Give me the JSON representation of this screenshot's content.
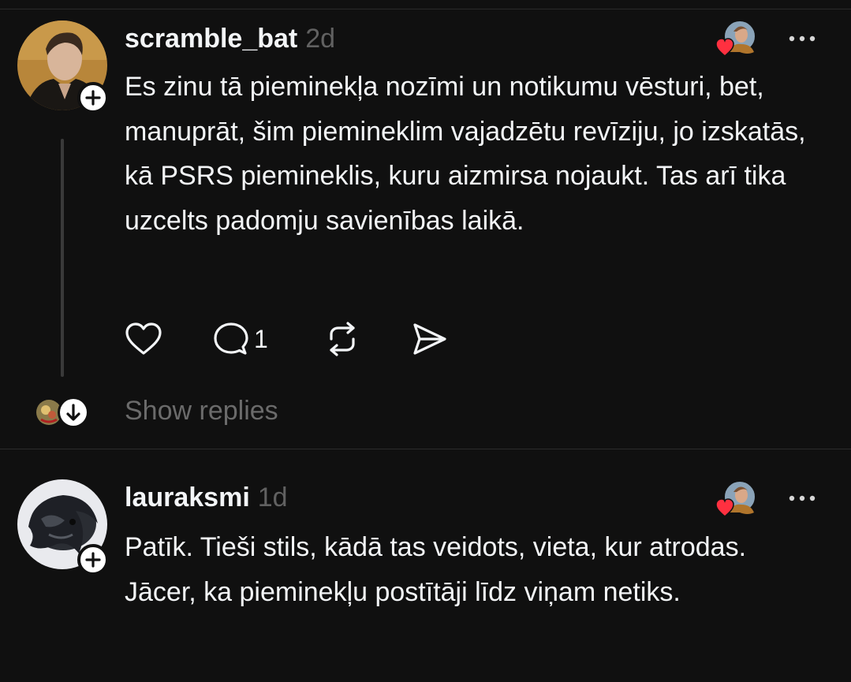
{
  "posts": [
    {
      "username": "scramble_bat",
      "time": "2d",
      "text": "Es zinu tā pieminekļa nozīmi un notikumu vēsturi, bet, manuprāt, šim piemineklim vajadzētu revīziju, jo izskatās, kā PSRS piemineklis, kuru aizmirsa nojaukt. Tas arī tika uzcelts padomju savienības laikā.",
      "reply_count": "1",
      "show_replies_label": "Show replies"
    },
    {
      "username": "lauraksmi",
      "time": "1d",
      "text": "Patīk. Tieši stils, kādā tas veidots, vieta, kur atrodas. Jācer, ka pieminekļu postītāji līdz viņam netiks."
    }
  ],
  "icons": {
    "follow": "plus-icon",
    "like": "heart-icon",
    "reply": "comment-icon",
    "repost": "repost-icon",
    "share": "send-icon",
    "more": "more-icon",
    "expand": "arrow-down-icon",
    "liked_by_author": "heart-badge-icon"
  },
  "colors": {
    "background": "#101010",
    "text_primary": "#f3f5f7",
    "text_secondary": "#616161",
    "heart_red": "#ff3040",
    "divider": "#2c2c2c"
  }
}
